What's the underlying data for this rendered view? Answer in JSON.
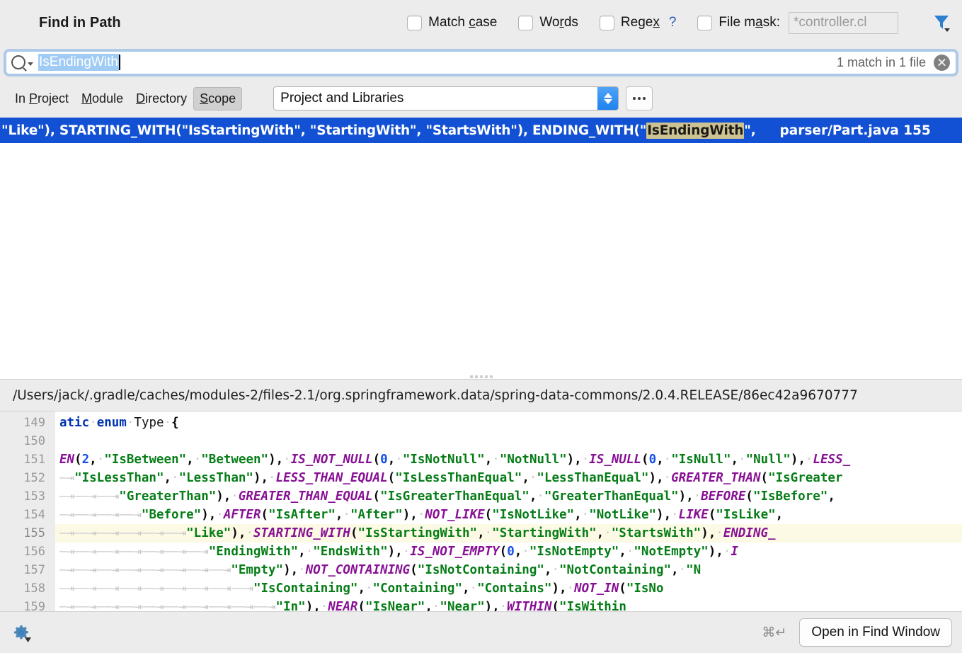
{
  "header": {
    "title": "Find in Path",
    "options": [
      {
        "id": "match-case",
        "label_pre": "Match ",
        "label_u": "c",
        "label_post": "ase",
        "checked": false
      },
      {
        "id": "words",
        "label_pre": "Wo",
        "label_u": "r",
        "label_post": "ds",
        "checked": false
      },
      {
        "id": "regex",
        "label_pre": "Rege",
        "label_u": "x",
        "label_post": "",
        "checked": false
      },
      {
        "id": "file-mask",
        "label_pre": "File m",
        "label_u": "a",
        "label_post": "sk:",
        "checked": false
      }
    ],
    "regex_help": "?",
    "file_mask_placeholder": "*controller.cl",
    "filter_icon": "filter-icon"
  },
  "search": {
    "query": "IsEndingWith",
    "match_status": "1 match in 1 file",
    "search_icon": "search-icon",
    "clear_icon": "clear-icon"
  },
  "scope": {
    "tabs": [
      {
        "pre": "In ",
        "u": "P",
        "post": "roject",
        "active": false
      },
      {
        "pre": "",
        "u": "M",
        "post": "odule",
        "active": false
      },
      {
        "pre": "",
        "u": "D",
        "post": "irectory",
        "active": false
      },
      {
        "pre": "",
        "u": "S",
        "post": "cope",
        "active": true
      }
    ],
    "selected": "Project and Libraries",
    "more_button": "..."
  },
  "results": {
    "rows": [
      {
        "prefix": "\"Like\"), STARTING_WITH(\"IsStartingWith\", \"StartingWith\", \"StartsWith\"), ENDING_WITH(\"",
        "match": "IsEndingWith",
        "suffix": "\",",
        "location": "parser/Part.java 155"
      }
    ]
  },
  "preview": {
    "path": "/Users/jack/.gradle/caches/modules-2/files-2.1/org.springframework.data/spring-data-commons/2.0.4.RELEASE/86ec42a9670777",
    "line_numbers": [
      "149",
      "150",
      "151",
      "152",
      "153",
      "154",
      "155",
      "156",
      "157",
      "158",
      "159"
    ],
    "highlighted_line": "155",
    "lines": [
      "atic enum Type {",
      "",
      "EN(2, \"IsBetween\", \"Between\"), IS_NOT_NULL(0, \"IsNotNull\", \"NotNull\"), IS_NULL(0, \"IsNull\", \"Null\"), LESS_",
      "\"IsLessThan\", \"LessThan\"), LESS_THAN_EQUAL(\"IsLessThanEqual\", \"LessThanEqual\"), GREATER_THAN(\"IsGreater",
      "\"GreaterThan\"), GREATER_THAN_EQUAL(\"IsGreaterThanEqual\", \"GreaterThanEqual\"), BEFORE(\"IsBefore\",",
      "\"Before\"), AFTER(\"IsAfter\", \"After\"), NOT_LIKE(\"IsNotLike\", \"NotLike\"), LIKE(\"IsLike\",",
      "\"Like\"), STARTING_WITH(\"IsStartingWith\", \"StartingWith\", \"StartsWith\"), ENDING_",
      "\"EndingWith\", \"EndsWith\"), IS_NOT_EMPTY(0, \"IsNotEmpty\", \"NotEmpty\"), I",
      "\"Empty\"), NOT_CONTAINING(\"IsNotContaining\", \"NotContaining\", \"N",
      "\"IsContaining\", \"Containing\", \"Contains\"), NOT_IN(\"IsNo",
      "\"In\"), NEAR(\"IsNear\", \"Near\"), WITHIN(\"IsWithin"
    ]
  },
  "bottom": {
    "settings_icon": "gear-icon",
    "shortcut": "⌘↵",
    "open_button": "Open in Find Window"
  },
  "colors": {
    "selection_blue": "#1251d3",
    "match_highlight": "#cdc291",
    "accent_blue": "#1f82f0",
    "line_highlight": "#fcfae4",
    "window_bg": "#ececec"
  }
}
